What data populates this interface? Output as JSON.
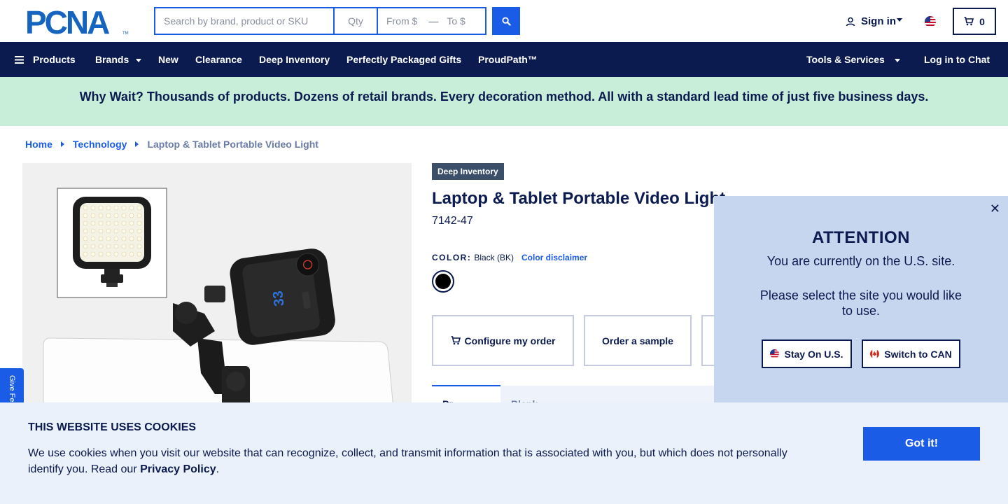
{
  "header": {
    "logo_text": "PCNA",
    "search_placeholder": "Search by brand, product or SKU",
    "qty_placeholder": "Qty",
    "from_placeholder": "From $",
    "to_placeholder": "To $",
    "signin_label": "Sign in",
    "cart_count": "0"
  },
  "nav": {
    "products": "Products",
    "brands": "Brands",
    "new": "New",
    "clearance": "Clearance",
    "deep_inventory": "Deep Inventory",
    "gifts": "Perfectly Packaged Gifts",
    "proudpath": "ProudPath™",
    "tools": "Tools & Services",
    "chat": "Log in to Chat"
  },
  "promo": {
    "text": "Why Wait? Thousands of products. Dozens of retail brands. Every decoration method. All with a standard lead time of just five business days."
  },
  "breadcrumb": {
    "home": "Home",
    "category": "Technology",
    "current": "Laptop & Tablet Portable Video Light"
  },
  "product": {
    "badge": "Deep Inventory",
    "title": "Laptop & Tablet Portable Video Light",
    "sku": "7142-47",
    "color_label": "COLOR:",
    "color_value": "Black (BK)",
    "color_disclaimer": "Color disclaimer",
    "swatch_color": "#000000",
    "configure_label": "Configure my order",
    "sample_label": "Order a sample",
    "tab_active_label": "Pr",
    "tab_second_label": "Blank"
  },
  "feedback": {
    "label": "Give Fe"
  },
  "region_modal": {
    "close": "✕",
    "title": "ATTENTION",
    "line1": "You are currently on the U.S. site.",
    "line2": "Please select the site you would like to use.",
    "stay_label": "Stay On U.S.",
    "switch_label": "Switch to CAN"
  },
  "cookies": {
    "title": "THIS WEBSITE USES COOKIES",
    "text_before": "We use cookies when you visit our website that can recognize, collect, and transmit information that is associated with you, but which does not personally identify you. Read our ",
    "policy_link": "Privacy Policy",
    "text_after": ".",
    "button": "Got it!"
  },
  "colors": {
    "navy": "#0b1a4f",
    "accent_blue": "#1a5ce6",
    "promo_green": "#c8eed9",
    "modal_bg": "#c5d6ee",
    "cookie_bg": "#eaf1fb"
  }
}
